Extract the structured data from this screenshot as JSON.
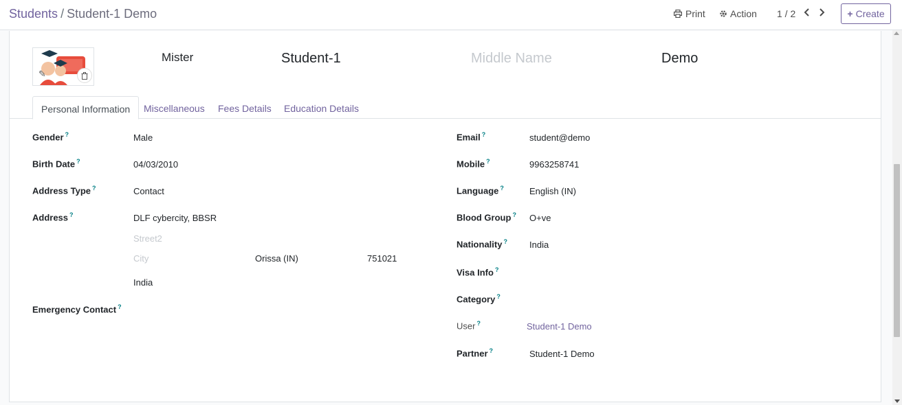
{
  "breadcrumb": {
    "parent": "Students",
    "current": "Student-1 Demo"
  },
  "toolbar": {
    "print_label": "Print",
    "action_label": "Action",
    "pager": "1 / 2",
    "create_label": "Create"
  },
  "header": {
    "title": "Mister",
    "first_name": "Student-1",
    "middle_name_placeholder": "Middle Name",
    "last_name": "Demo"
  },
  "tabs": [
    "Personal Information",
    "Miscellaneous",
    "Fees Details",
    "Education Details"
  ],
  "left": {
    "gender": {
      "label": "Gender",
      "value": "Male"
    },
    "birth_date": {
      "label": "Birth Date",
      "value": "04/03/2010"
    },
    "address_type": {
      "label": "Address Type",
      "value": "Contact"
    },
    "address": {
      "label": "Address",
      "street": "DLF cybercity, BBSR",
      "street2_placeholder": "Street2",
      "city_placeholder": "City",
      "state": "Orissa (IN)",
      "zip": "751021",
      "country": "India"
    },
    "emergency_contact": {
      "label": "Emergency Contact"
    }
  },
  "right": {
    "email": {
      "label": "Email",
      "value": "student@demo"
    },
    "mobile": {
      "label": "Mobile",
      "value": "9963258741"
    },
    "language": {
      "label": "Language",
      "value": "English (IN)"
    },
    "blood_group": {
      "label": "Blood Group",
      "value": "O+ve"
    },
    "nationality": {
      "label": "Nationality",
      "value": "India"
    },
    "visa_info": {
      "label": "Visa Info"
    },
    "category": {
      "label": "Category"
    },
    "user": {
      "label": "User",
      "value": "Student-1 Demo"
    },
    "partner": {
      "label": "Partner",
      "value": "Student-1 Demo"
    }
  },
  "help_mark": "?"
}
